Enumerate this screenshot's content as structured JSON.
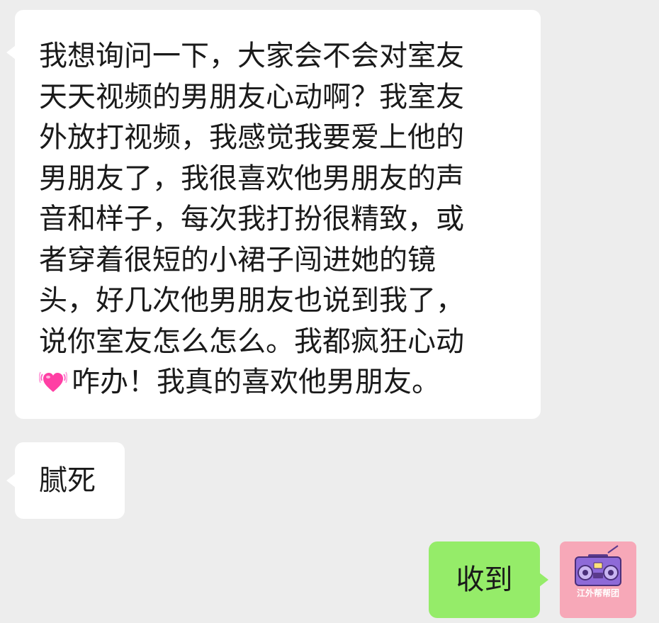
{
  "messages": [
    {
      "side": "incoming",
      "lines": [
        "我想询问一下，大家会不会对室友",
        "天天视频的男朋友心动啊？我室友",
        "外放打视频，我感觉我要爱上他的",
        "男朋友了，我很喜欢他男朋友的声",
        "音和样子，每次我打扮很精致，或",
        "者穿着很短的小裙子闯进她的镜",
        "头，好几次他男朋友也说到我了，",
        "说你室友怎么怎么。我都疯狂心动"
      ],
      "last_line_icon": "growing-heart-emoji",
      "last_line_text": "咋办！我真的喜欢他男朋友。"
    },
    {
      "side": "incoming",
      "text": "腻死"
    },
    {
      "side": "outgoing",
      "text": "收到"
    }
  ],
  "avatar": {
    "icon": "boombox-icon",
    "text": "江外帮帮团",
    "background": "#f7a8b8"
  },
  "colors": {
    "chat_background": "#ededed",
    "incoming_bubble": "#ffffff",
    "outgoing_bubble": "#95ec69"
  }
}
